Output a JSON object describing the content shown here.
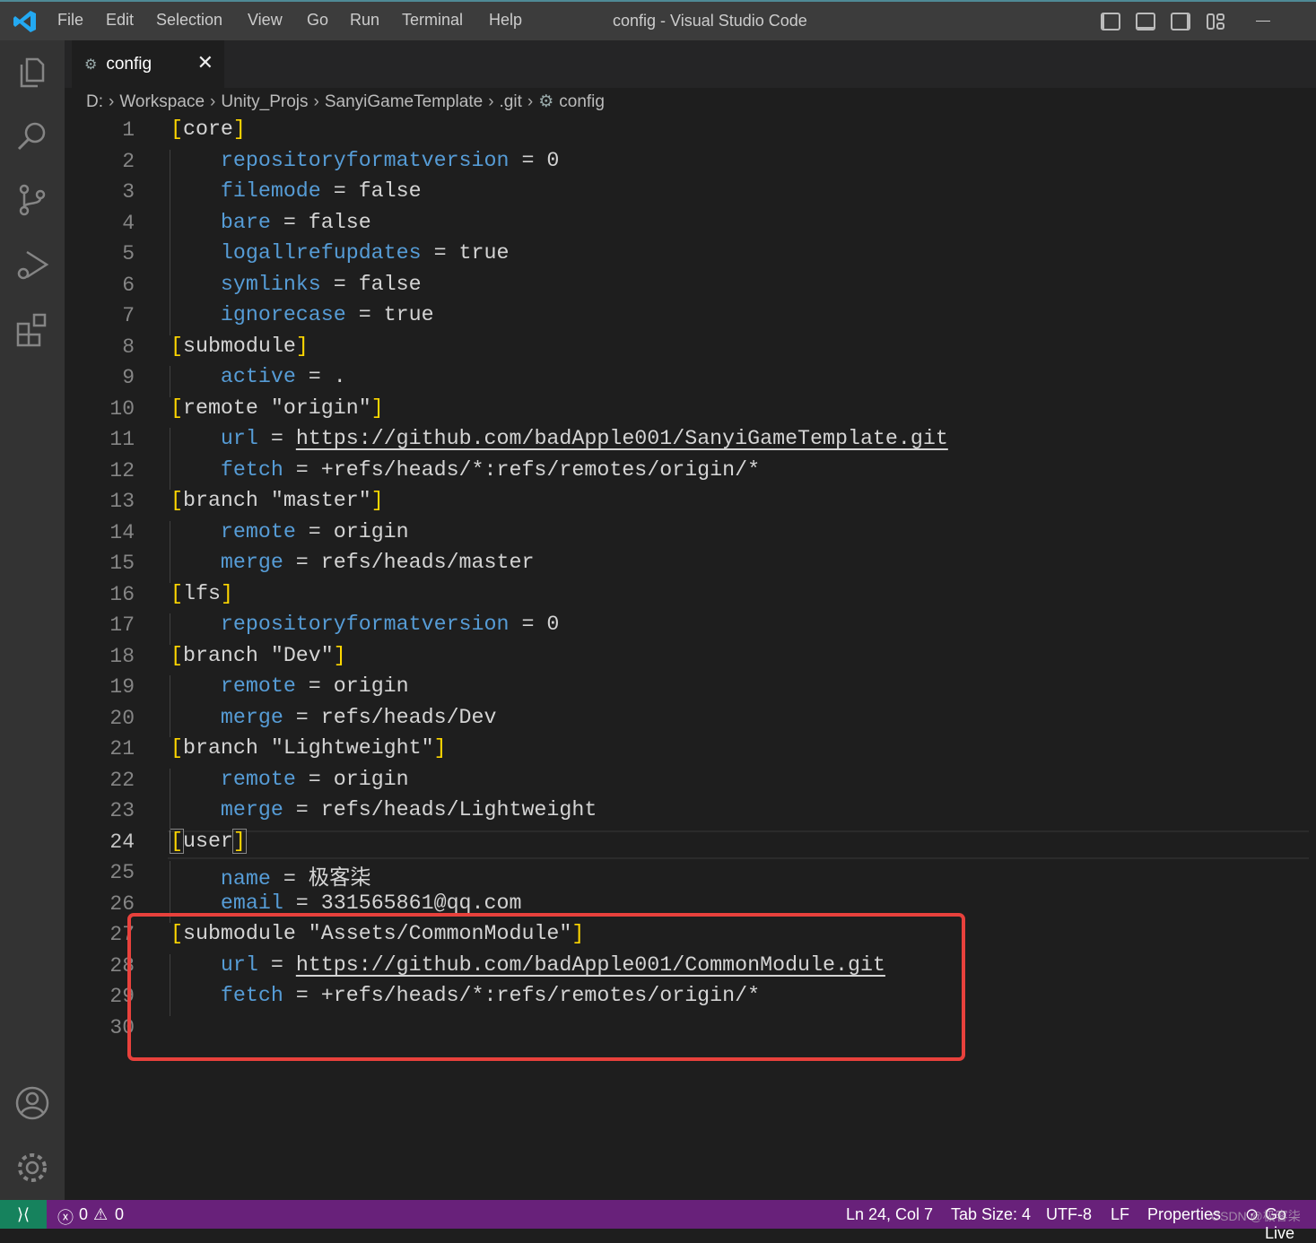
{
  "window": {
    "title": "config - Visual Studio Code"
  },
  "menu": [
    "File",
    "Edit",
    "Selection",
    "View",
    "Go",
    "Run",
    "Terminal",
    "Help"
  ],
  "tab": {
    "label": "config",
    "close": "✕"
  },
  "breadcrumb": [
    "D:",
    "Workspace",
    "Unity_Projs",
    "SanyiGameTemplate",
    ".git",
    "config"
  ],
  "editor": {
    "current_line": 24,
    "lines": [
      [
        {
          "t": "[",
          "c": "b"
        },
        {
          "t": "core"
        },
        {
          "t": "]",
          "c": "b"
        }
      ],
      [
        {
          "t": "    "
        },
        {
          "t": "repositoryformatversion",
          "c": "k"
        },
        {
          "t": " = 0"
        }
      ],
      [
        {
          "t": "    "
        },
        {
          "t": "filemode",
          "c": "k"
        },
        {
          "t": " = false"
        }
      ],
      [
        {
          "t": "    "
        },
        {
          "t": "bare",
          "c": "k"
        },
        {
          "t": " = false"
        }
      ],
      [
        {
          "t": "    "
        },
        {
          "t": "logallrefupdates",
          "c": "k"
        },
        {
          "t": " = true"
        }
      ],
      [
        {
          "t": "    "
        },
        {
          "t": "symlinks",
          "c": "k"
        },
        {
          "t": " = false"
        }
      ],
      [
        {
          "t": "    "
        },
        {
          "t": "ignorecase",
          "c": "k"
        },
        {
          "t": " = true"
        }
      ],
      [
        {
          "t": "[",
          "c": "b"
        },
        {
          "t": "submodule"
        },
        {
          "t": "]",
          "c": "b"
        }
      ],
      [
        {
          "t": "    "
        },
        {
          "t": "active",
          "c": "k"
        },
        {
          "t": " = ."
        }
      ],
      [
        {
          "t": "[",
          "c": "b"
        },
        {
          "t": "remote \"origin\""
        },
        {
          "t": "]",
          "c": "b"
        }
      ],
      [
        {
          "t": "    "
        },
        {
          "t": "url",
          "c": "k"
        },
        {
          "t": " = "
        },
        {
          "t": "https://github.com/badApple001/SanyiGameTemplate.git",
          "c": "u"
        }
      ],
      [
        {
          "t": "    "
        },
        {
          "t": "fetch",
          "c": "k"
        },
        {
          "t": " = +refs/heads/*:refs/remotes/origin/*"
        }
      ],
      [
        {
          "t": "[",
          "c": "b"
        },
        {
          "t": "branch \"master\""
        },
        {
          "t": "]",
          "c": "b"
        }
      ],
      [
        {
          "t": "    "
        },
        {
          "t": "remote",
          "c": "k"
        },
        {
          "t": " = origin"
        }
      ],
      [
        {
          "t": "    "
        },
        {
          "t": "merge",
          "c": "k"
        },
        {
          "t": " = refs/heads/master"
        }
      ],
      [
        {
          "t": "[",
          "c": "b"
        },
        {
          "t": "lfs"
        },
        {
          "t": "]",
          "c": "b"
        }
      ],
      [
        {
          "t": "    "
        },
        {
          "t": "repositoryformatversion",
          "c": "k"
        },
        {
          "t": " = 0"
        }
      ],
      [
        {
          "t": "[",
          "c": "b"
        },
        {
          "t": "branch \"Dev\""
        },
        {
          "t": "]",
          "c": "b"
        }
      ],
      [
        {
          "t": "    "
        },
        {
          "t": "remote",
          "c": "k"
        },
        {
          "t": " = origin"
        }
      ],
      [
        {
          "t": "    "
        },
        {
          "t": "merge",
          "c": "k"
        },
        {
          "t": " = refs/heads/Dev"
        }
      ],
      [
        {
          "t": "[",
          "c": "b"
        },
        {
          "t": "branch \"Lightweight\""
        },
        {
          "t": "]",
          "c": "b"
        }
      ],
      [
        {
          "t": "    "
        },
        {
          "t": "remote",
          "c": "k"
        },
        {
          "t": " = origin"
        }
      ],
      [
        {
          "t": "    "
        },
        {
          "t": "merge",
          "c": "k"
        },
        {
          "t": " = refs/heads/Lightweight"
        }
      ],
      [
        {
          "t": "[",
          "c": "b bb"
        },
        {
          "t": "user"
        },
        {
          "t": "]",
          "c": "b bb"
        }
      ],
      [
        {
          "t": "    "
        },
        {
          "t": "name",
          "c": "k"
        },
        {
          "t": " = 极客柒"
        }
      ],
      [
        {
          "t": "    "
        },
        {
          "t": "email",
          "c": "k"
        },
        {
          "t": " = 331565861@qq.com"
        }
      ],
      [
        {
          "t": "[",
          "c": "b"
        },
        {
          "t": "submodule \"Assets/CommonModule\""
        },
        {
          "t": "]",
          "c": "b"
        }
      ],
      [
        {
          "t": "    "
        },
        {
          "t": "url",
          "c": "k"
        },
        {
          "t": " = "
        },
        {
          "t": "https://github.com/badApple001/CommonModule.git",
          "c": "u"
        }
      ],
      [
        {
          "t": "    "
        },
        {
          "t": "fetch",
          "c": "k"
        },
        {
          "t": " = +refs/heads/*:refs/remotes/origin/*"
        }
      ],
      []
    ]
  },
  "status": {
    "errors": "0",
    "warnings": "0",
    "position": "Ln 24, Col 7",
    "tab_size": "Tab Size: 4",
    "encoding": "UTF-8",
    "eol": "LF",
    "language": "Properties",
    "golive": "Go Live",
    "watermark": "CSDN @极客柒"
  },
  "colors": {
    "status_bar": "#68217a",
    "remote": "#16825d",
    "highlight_box": "#e8413c",
    "key": "#569cd6",
    "bracket": "#ffd700"
  }
}
